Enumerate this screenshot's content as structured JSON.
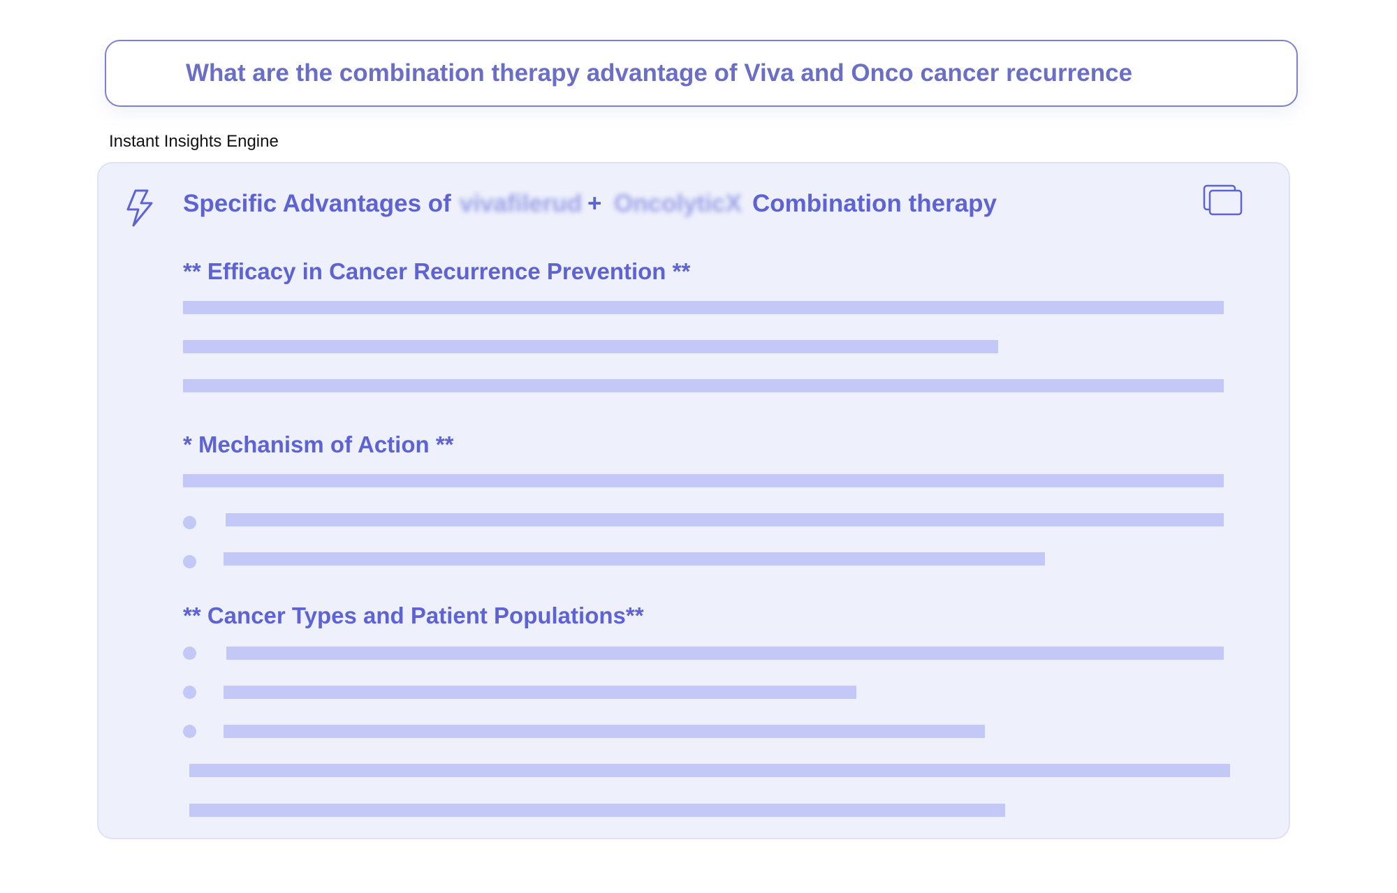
{
  "query": {
    "text": "What are the combination therapy advantage of Viva and Onco cancer recurrence"
  },
  "engine_label": "Instant Insights Engine",
  "answer": {
    "title_prefix": "Specific Advantages of",
    "drug_a": "vivafilerud",
    "plus": "+",
    "drug_b": "OncolyticX",
    "title_suffix": "Combination therapy",
    "sections": [
      {
        "heading": "** Efficacy in Cancer Recurrence Prevention **"
      },
      {
        "heading": "* Mechanism of Action **"
      },
      {
        "heading": "** Cancer Types and Patient Populations**"
      }
    ]
  },
  "icons": {
    "bolt": "lightning-bolt-icon",
    "copy": "copy-icon"
  },
  "colors": {
    "accent": "#5d63d3",
    "query_text": "#6a6ec5",
    "border": "#7b7fd6",
    "card_bg": "#eef0fb",
    "placeholder": "#c4c8f6"
  }
}
